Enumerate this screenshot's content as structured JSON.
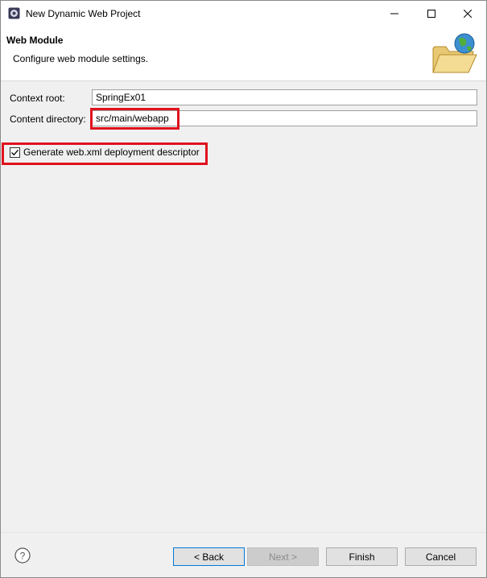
{
  "window": {
    "title": "New Dynamic Web Project",
    "icon": "eclipse-gear-icon"
  },
  "banner": {
    "title": "Web Module",
    "description": "Configure web module settings.",
    "image": "folder-globe-icon"
  },
  "form": {
    "context_root": {
      "label": "Context root:",
      "value": "SpringEx01"
    },
    "content_directory": {
      "label": "Content directory:",
      "value": "src/main/webapp"
    },
    "generate_web_xml": {
      "label": "Generate web.xml deployment descriptor",
      "checked": true
    }
  },
  "footer": {
    "help_icon": "help-icon",
    "back_label": "< Back",
    "next_label": "Next >",
    "finish_label": "Finish",
    "cancel_label": "Cancel"
  },
  "colors": {
    "highlight": "#e0121f",
    "accent_border": "#0078d7"
  }
}
